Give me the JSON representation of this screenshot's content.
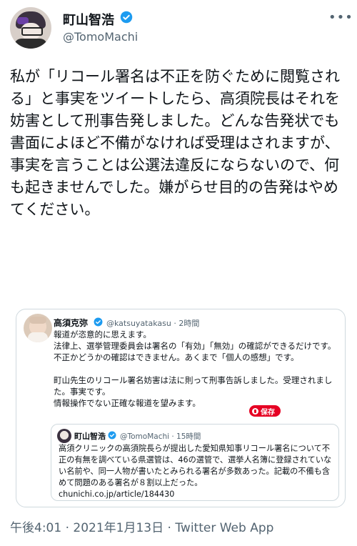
{
  "author": {
    "name": "町山智浩",
    "handle": "@TomoMachi"
  },
  "menu": {
    "more": "•••"
  },
  "tweet": {
    "text": "私が「リコール署名は不正を防ぐために閲覧される」と事実をツイートしたら、高須院長はそれを妨害として刑事告発しました。どんな告発状でも書面によほど不備がなければ受理はされますが、事実を言うことは公選法違反にならないので、何も起きませんでした。嫌がらせ目的の告発はやめてください。"
  },
  "quoted": {
    "name": "高須克弥",
    "handle": "@katsuyatakasu · 2時間",
    "text": "報道が恣意的に思えます。\n法律上、選挙管理委員会は署名の「有効」「無効」の確認ができるだけです。\n不正かどうかの確認はできません。あくまで「個人の感想」です。\n\n町山先生のリコール署名妨害は法に則って刑事告訴しました。受理されました。事実です。\n情報操作でない正確な報道を望みます。",
    "save_label": "保存",
    "nested": {
      "name": "町山智浩",
      "handle": "@TomoMachi · 15時間",
      "text": "高須クリニックの高須院長らが提出した愛知県知事リコール署名について不正の有無を調べている県選管は、46の選管で、選挙人名簿に登録されていない名前や、同一人物が書いたとみられる署名が多数あった。記載の不備も含めて問題のある署名が８割以上だった。\nchunichi.co.jp/article/184430"
    }
  },
  "meta": {
    "time": "午後4:01",
    "date": "2021年1月13日",
    "source": "Twitter Web App",
    "sep": " · "
  }
}
